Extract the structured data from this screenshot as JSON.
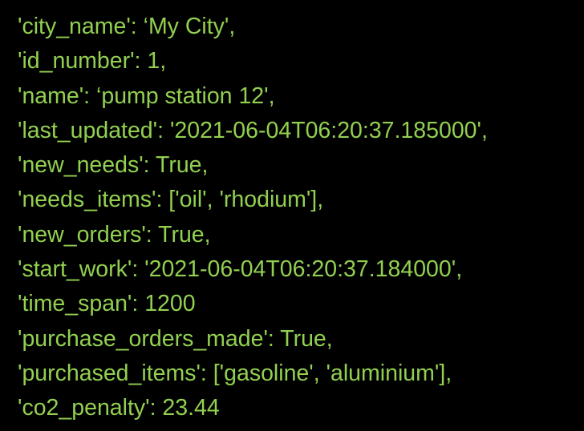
{
  "colors": {
    "background": "#000000",
    "text": "#92d050"
  },
  "lines": [
    "'city_name': ‘My City',",
    "'id_number': 1,",
    "'name': ‘pump station 12',",
    "'last_updated': '2021-06-04T06:20:37.185000',",
    "'new_needs': True,",
    "'needs_items': ['oil', 'rhodium'],",
    "'new_orders': True,",
    "'start_work': '2021-06-04T06:20:37.184000',",
    "'time_span': 1200",
    "'purchase_orders_made': True,",
    "'purchased_items': ['gasoline', 'aluminium'],",
    "'co2_penalty': 23.44"
  ]
}
